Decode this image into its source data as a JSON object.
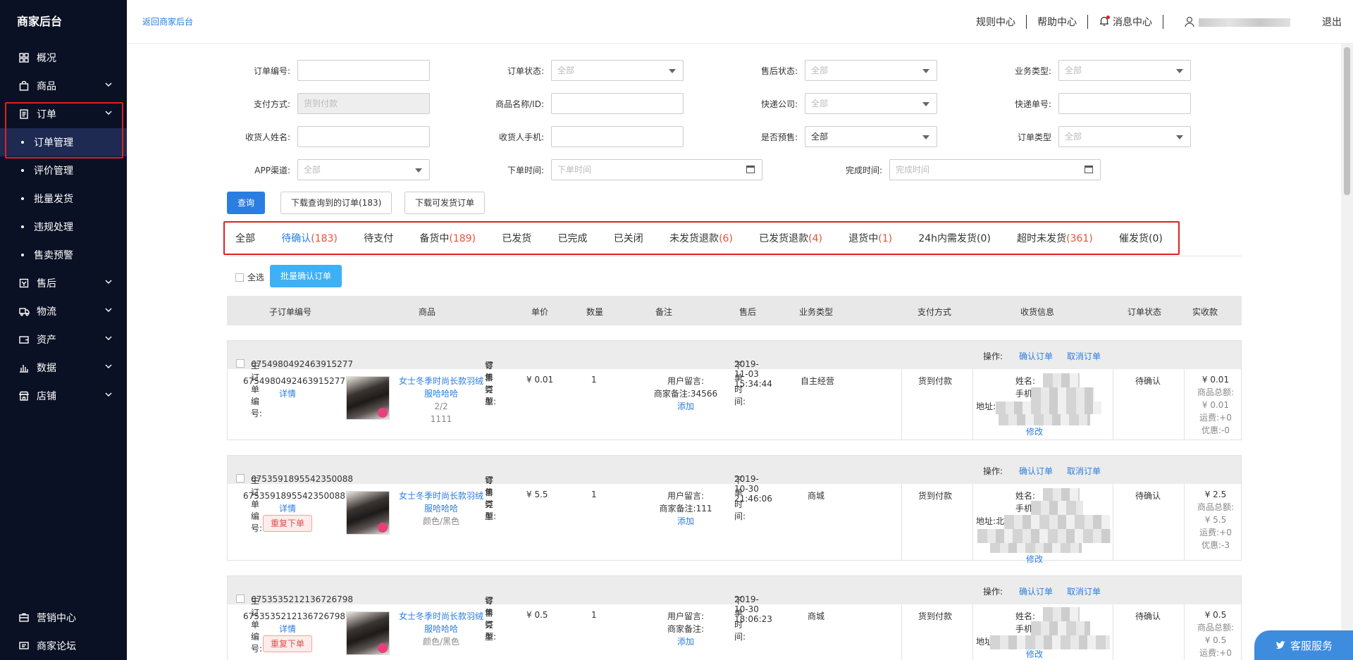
{
  "sidebar": {
    "brand": "商家后台",
    "menu": [
      {
        "label": "概况",
        "icon": "grid-icon"
      },
      {
        "label": "商品",
        "icon": "bag-icon"
      },
      {
        "label": "订单",
        "icon": "document-icon"
      },
      {
        "label": "售后",
        "icon": "aftersale-icon"
      },
      {
        "label": "物流",
        "icon": "truck-icon"
      },
      {
        "label": "资产",
        "icon": "wallet-icon"
      },
      {
        "label": "数据",
        "icon": "bar-chart-icon"
      },
      {
        "label": "店铺",
        "icon": "store-icon"
      }
    ],
    "order_sub": [
      "订单管理",
      "评价管理",
      "批量发货",
      "违规处理",
      "售卖预警"
    ],
    "bottom": [
      {
        "label": "营销中心",
        "icon": "marketing-icon"
      },
      {
        "label": "商家论坛",
        "icon": "forum-icon"
      }
    ]
  },
  "topbar": {
    "back_link": "返回商家后台",
    "rules": "规则中心",
    "help": "帮助中心",
    "messages": "消息中心",
    "logout": "退出"
  },
  "filters": {
    "order_no": "订单编号:",
    "order_status": "订单状态:",
    "order_status_value": "全部",
    "aftersale_status": "售后状态:",
    "aftersale_status_value": "全部",
    "business_type": "业务类型:",
    "business_type_value": "全部",
    "payment": "支付方式:",
    "payment_value": "货到付款",
    "product": "商品名称/ID:",
    "courier": "快递公司:",
    "courier_value": "全部",
    "tracking": "快递单号:",
    "receiver_name": "收货人姓名:",
    "receiver_phone": "收货人手机:",
    "presale": "是否预售:",
    "presale_value": "全部",
    "order_type": "订单类型",
    "order_type_value": "全部",
    "app_channel": "APP渠道:",
    "app_channel_value": "全部",
    "order_time": "下单时间:",
    "order_time_placeholder": "下单时间",
    "finish_time": "完成时间:",
    "finish_time_placeholder": "完成时间"
  },
  "actions": {
    "query": "查询",
    "download_queried": "下载查询到的订单(183)",
    "download_shippable": "下载可发货订单"
  },
  "tabs": [
    {
      "label": "全部",
      "count": ""
    },
    {
      "label": "待确认",
      "count": "(183)"
    },
    {
      "label": "待支付",
      "count": ""
    },
    {
      "label": "备货中",
      "count": "(189)"
    },
    {
      "label": "已发货",
      "count": ""
    },
    {
      "label": "已完成",
      "count": ""
    },
    {
      "label": "已关闭",
      "count": ""
    },
    {
      "label": "未发货退款",
      "count": "(6)"
    },
    {
      "label": "已发货退款",
      "count": "(4)"
    },
    {
      "label": "退货中",
      "count": "(1)"
    },
    {
      "label": "24h内需发货(0)",
      "count": ""
    },
    {
      "label": "超时未发货",
      "count": "(361)"
    },
    {
      "label": "催发货(0)",
      "count": ""
    }
  ],
  "bulk": {
    "select_all": "全选",
    "confirm_batch": "批量确认订单"
  },
  "table_headers": [
    "子订单编号",
    "商品",
    "单价",
    "数量",
    "备注",
    "售后",
    "业务类型",
    "支付方式",
    "收货信息",
    "订单状态",
    "实收款"
  ],
  "labels": {
    "main_order": "主订单编号:",
    "order_type": "订单类型:",
    "order_time": "下单时间:",
    "operation": "操作:",
    "confirm": "确认订单",
    "cancel": "取消订单",
    "detail": "详情",
    "reorder": "重复下单",
    "user_note": "用户留言:",
    "merchant_note": "商家备注:",
    "add": "添加",
    "name": "姓名:",
    "phone": "手机",
    "address": "地址:",
    "edit": "修改",
    "goods_total": "商品总额:",
    "shipping": "运费:",
    "discount": "优惠:"
  },
  "orders": [
    {
      "main_no": "6754980492463915277",
      "type": "零售订单",
      "time": "2019-11-03 15:34:44",
      "sub_no": "6754980492463915277",
      "product": "女士冬季时尚长款羽绒服哈哈哈",
      "spec1": "2/2",
      "spec2": "1111",
      "price": "¥ 0.01",
      "qty": "1",
      "merchant_note": "34566",
      "biz": "自主经营",
      "pay": "货到付款",
      "status": "待确认",
      "received": "¥ 0.01",
      "goods_total": "¥ 0.01",
      "shipping": "+0",
      "discount": "-0"
    },
    {
      "main_no": "6753591895542350088",
      "type": "零售订单",
      "time": "2019-10-30 21:46:06",
      "sub_no": "6753591895542350088",
      "product": "女士冬季时尚长款羽绒服哈哈哈",
      "spec1": "颜色/黑色",
      "price": "¥ 5.5",
      "qty": "1",
      "merchant_note": "111",
      "biz": "商城",
      "pay": "货到付款",
      "status": "待确认",
      "received": "¥ 2.5",
      "goods_total": "¥ 5.5",
      "shipping": "+0",
      "discount": "-3",
      "address_prefix": "北"
    },
    {
      "main_no": "6753535212136726798",
      "type": "零售订单",
      "time": "2019-10-30 18:06:23",
      "sub_no": "6753535212136726798",
      "product": "女士冬季时尚长款羽绒服哈哈哈",
      "spec1": "颜色/黑色",
      "price": "¥ 0.5",
      "qty": "1",
      "merchant_note": "",
      "biz": "商城",
      "pay": "货到付款",
      "status": "待确认",
      "received": "¥ 0.5",
      "goods_total": "¥ 0.5",
      "shipping": "+0"
    }
  ],
  "service": "客服服务",
  "colors": {
    "sidebar": "#0b1124",
    "accent": "#2a7de1",
    "highlight": "#e02020",
    "count": "#e8503a"
  }
}
